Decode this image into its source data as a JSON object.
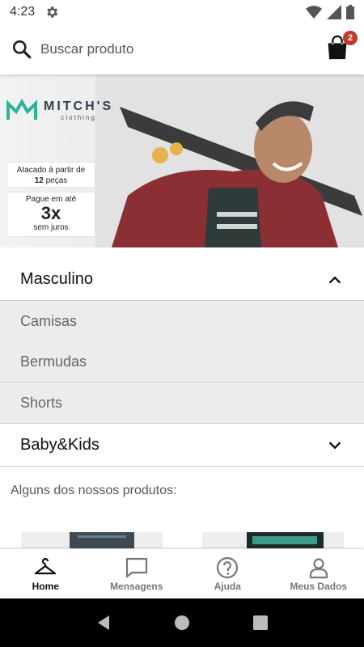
{
  "status_bar": {
    "time": "4:23"
  },
  "search": {
    "placeholder": "Buscar produto",
    "cart_count": "2"
  },
  "banner": {
    "brand_name": "MITCH'S",
    "brand_sub": "clothing",
    "promo_1_line1": "Atacado à partir de",
    "promo_1_qty": "12",
    "promo_1_unit": "peças",
    "promo_2_line1": "Pague em até",
    "promo_2_big": "3x",
    "promo_2_line3": "sem juros"
  },
  "categories": [
    {
      "label": "Masculino",
      "expanded": true,
      "items": [
        {
          "label": "Camisas"
        },
        {
          "label": "Bermudas"
        },
        {
          "label": "Shorts"
        }
      ]
    },
    {
      "label": "Baby&Kids",
      "expanded": false
    }
  ],
  "section_title": "Alguns dos nossos produtos:",
  "bottom_nav": [
    {
      "label": "Home",
      "icon": "hanger-icon",
      "active": true
    },
    {
      "label": "Mensagens",
      "icon": "message-icon",
      "active": false
    },
    {
      "label": "Ajuda",
      "icon": "help-icon",
      "active": false
    },
    {
      "label": "Meus Dados",
      "icon": "user-icon",
      "active": false
    }
  ],
  "colors": {
    "accent": "#2bb39a",
    "badge": "#c0392b",
    "nav_bg": "#000000"
  }
}
